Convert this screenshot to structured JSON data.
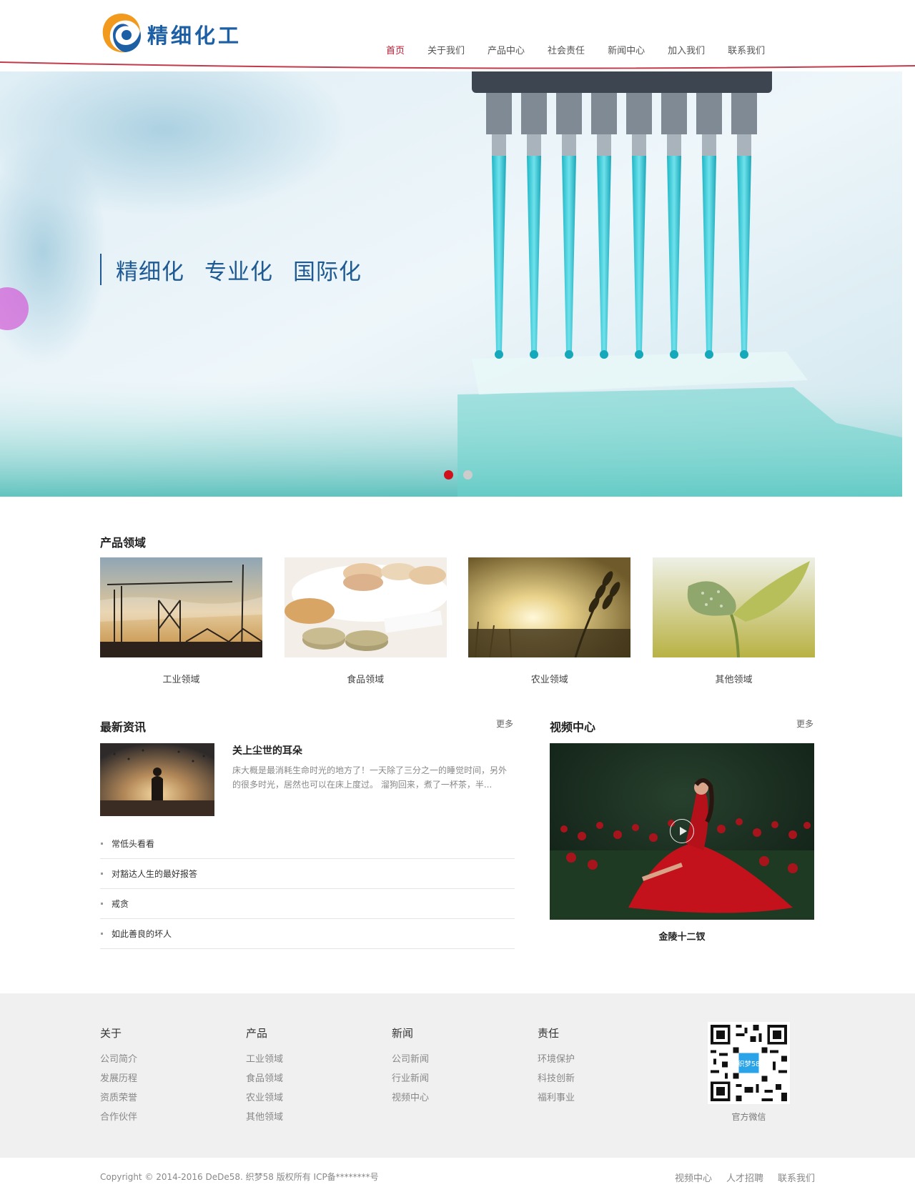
{
  "brand": {
    "name": "精细化工",
    "color": "#1d5fa5",
    "accent": "#c4152b"
  },
  "nav": [
    {
      "label": "首页",
      "active": true
    },
    {
      "label": "关于我们"
    },
    {
      "label": "产品中心"
    },
    {
      "label": "社会责任"
    },
    {
      "label": "新闻中心"
    },
    {
      "label": "加入我们"
    },
    {
      "label": "联系我们"
    }
  ],
  "hero": {
    "slogan": [
      "精细化",
      "专业化",
      "国际化"
    ],
    "slides": 2,
    "active_slide": 1
  },
  "products": {
    "title": "产品领域",
    "items": [
      {
        "label": "工业领域",
        "icon": "construction-crane-image"
      },
      {
        "label": "食品领域",
        "icon": "macaron-biscuit-image"
      },
      {
        "label": "农业领域",
        "icon": "wheat-sunset-image"
      },
      {
        "label": "其他领域",
        "icon": "leaf-sprout-image"
      }
    ]
  },
  "news": {
    "title": "最新资讯",
    "more": "更多",
    "feature": {
      "title": "关上尘世的耳朵",
      "desc": "床大概是最消耗生命时光的地方了！一天除了三分之一的睡觉时间，另外的很多时光，居然也可以在床上度过。 溜狗回来，煮了一杯茶，半..."
    },
    "list": [
      "常低头看看",
      "对豁达人生的最好报答",
      "戒贪",
      "如此善良的坏人"
    ]
  },
  "video": {
    "title": "视频中心",
    "more": "更多",
    "caption": "金陵十二钗"
  },
  "footer": {
    "columns": [
      {
        "title": "关于",
        "links": [
          "公司简介",
          "发展历程",
          "资质荣誉",
          "合作伙伴"
        ]
      },
      {
        "title": "产品",
        "links": [
          "工业领域",
          "食品领域",
          "农业领域",
          "其他领域"
        ]
      },
      {
        "title": "新闻",
        "links": [
          "公司新闻",
          "行业新闻",
          "视频中心"
        ]
      },
      {
        "title": "责任",
        "links": [
          "环境保护",
          "科技创新",
          "福利事业"
        ]
      }
    ],
    "qr_caption": "官方微信",
    "qr_badge": "织梦58",
    "copyright": "Copyright © 2014-2016 DeDe58. 织梦58 版权所有   ICP备********号",
    "bottom_links": [
      "视频中心",
      "人才招聘",
      "联系我们"
    ]
  }
}
